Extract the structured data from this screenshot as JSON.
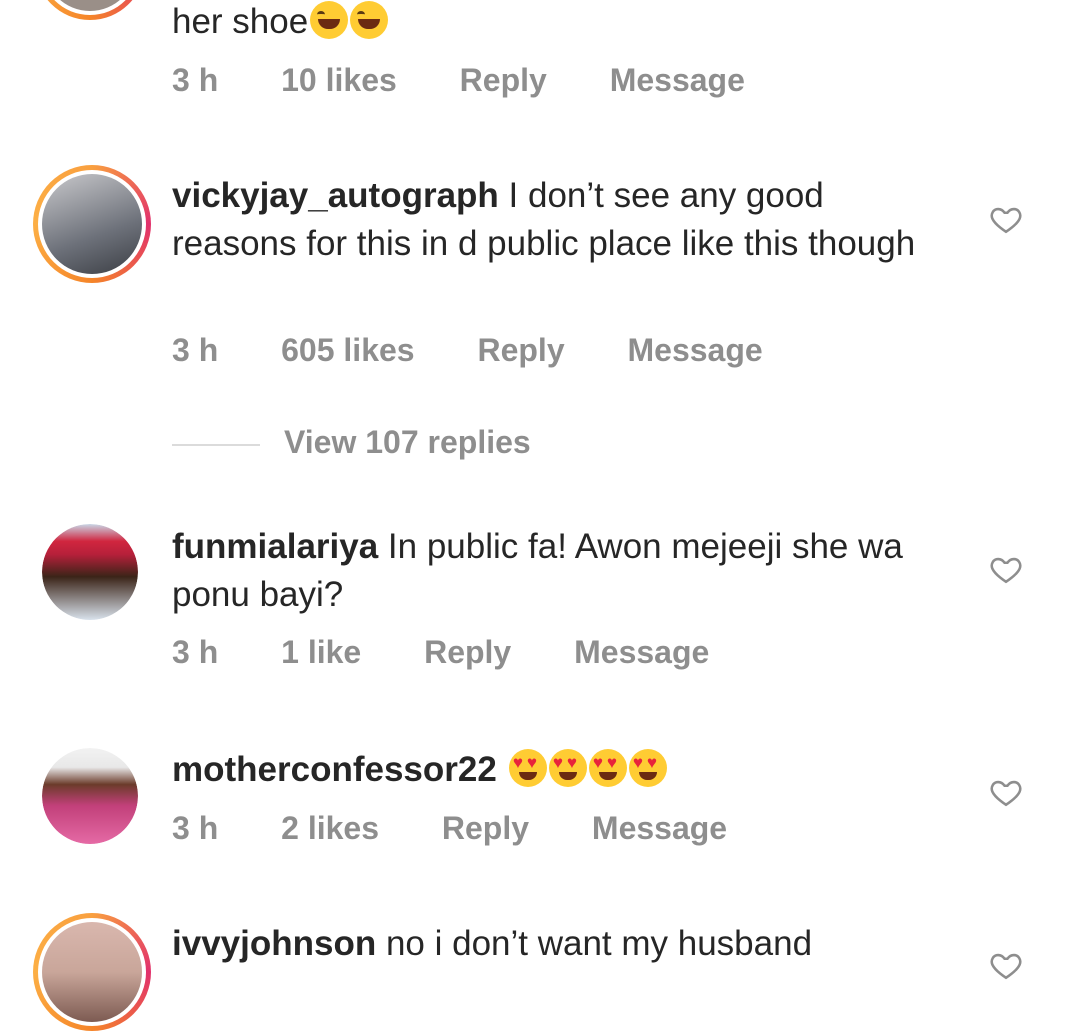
{
  "comments": [
    {
      "text": "her shoe",
      "emojis": [
        "laugh",
        "laugh"
      ],
      "time": "3 h",
      "likes": "10 likes",
      "reply": "Reply",
      "message": "Message"
    },
    {
      "username": "vickyjay_autograph",
      "text": " I don’t see any good reasons for this in d public place like this though",
      "time": "3 h",
      "likes": "605 likes",
      "reply": "Reply",
      "message": "Message",
      "view_replies": "View 107 replies",
      "avatar_color": "#8a8f98"
    },
    {
      "username": "funmialariya",
      "text": " In public fa! Awon mejeeji she wa ponu bayi?",
      "time": "3 h",
      "likes": "1 like",
      "reply": "Reply",
      "message": "Message",
      "avatar_color": "#b5203a"
    },
    {
      "username": "motherconfessor22",
      "emojis": [
        "love",
        "love",
        "love",
        "love"
      ],
      "time": "3 h",
      "likes": "2 likes",
      "reply": "Reply",
      "message": "Message",
      "avatar_color": "#c2407a"
    },
    {
      "username": "ivvyjohnson",
      "text": " no i don’t want my husband",
      "avatar_color": "#c9a69a"
    }
  ],
  "colors": {
    "text": "#262626",
    "meta": "#8e8e8e",
    "divider": "#dbdbdb",
    "story_ring": "#e1306c"
  },
  "icons": [
    "heart-icon",
    "laugh-emoji",
    "heart-eyes-emoji"
  ]
}
